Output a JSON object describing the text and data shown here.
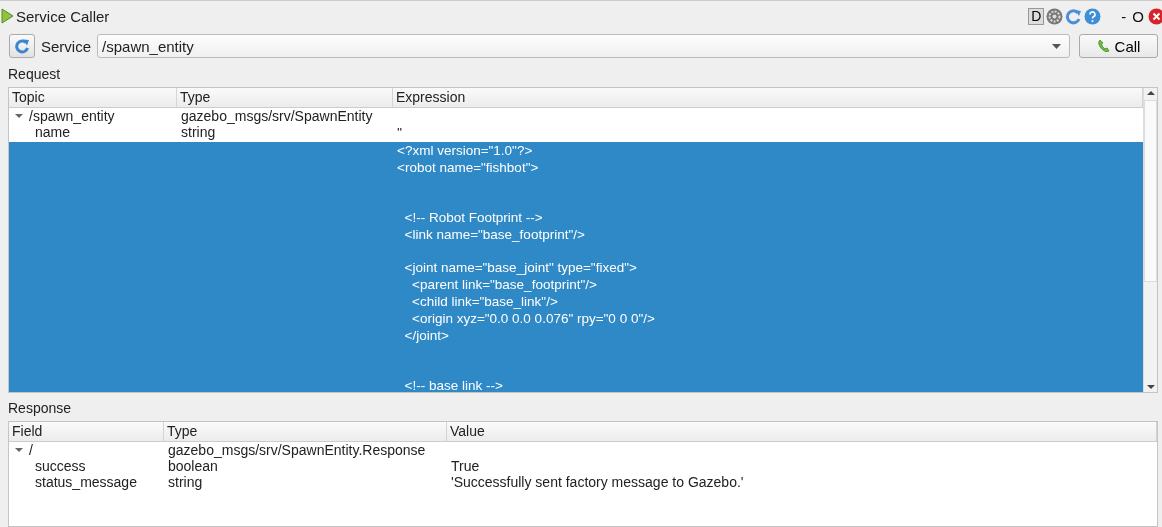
{
  "window": {
    "title": "Service Caller",
    "title_buttons": {
      "dock": "D",
      "minimize": "-",
      "float": "O"
    }
  },
  "toolbar": {
    "service_label": "Service",
    "service_value": "/spawn_entity",
    "call_button": "Call"
  },
  "request": {
    "label": "Request",
    "columns": [
      "Topic",
      "Type",
      "Expression"
    ],
    "rows": [
      {
        "topic": "/spawn_entity",
        "type": "gazebo_msgs/srv/SpawnEntity",
        "expanded": true,
        "selected": false,
        "children": [
          {
            "topic": "name",
            "type": "string",
            "expression": "''",
            "selected": false
          },
          {
            "expression": "<?xml version=\"1.0\"?>\n<robot name=\"fishbot\">\n\n\n  <!-- Robot Footprint -->\n  <link name=\"base_footprint\"/>\n\n  <joint name=\"base_joint\" type=\"fixed\">\n    <parent link=\"base_footprint\"/>\n    <child link=\"base_link\"/>\n    <origin xyz=\"0.0 0.0 0.076\" rpy=\"0 0 0\"/>\n  </joint>\n\n\n  <!-- base link -->",
            "selected": true
          }
        ]
      }
    ]
  },
  "response": {
    "label": "Response",
    "columns": [
      "Field",
      "Type",
      "Value"
    ],
    "rows": [
      {
        "field": "/",
        "type": "gazebo_msgs/srv/SpawnEntity.Response",
        "expanded": true,
        "selected": false,
        "children": [
          {
            "field": "success",
            "type": "boolean",
            "value": "True",
            "selected": false
          },
          {
            "field": "status_message",
            "type": "string",
            "value": "'Successfully sent factory message to Gazebo.'",
            "selected": false
          }
        ]
      }
    ]
  }
}
